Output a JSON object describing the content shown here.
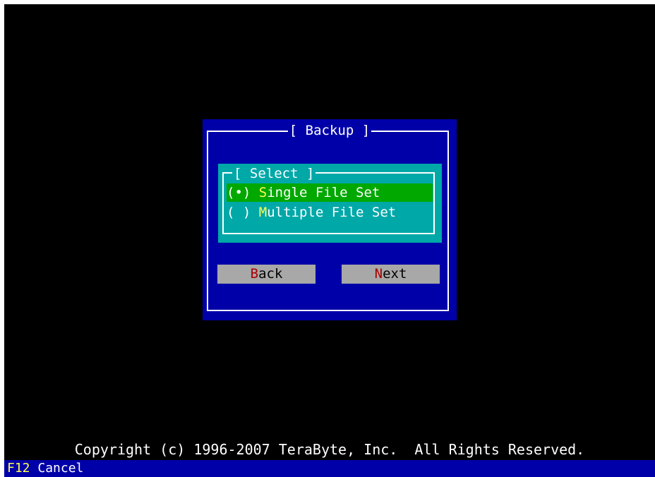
{
  "dialog": {
    "title": "[ Backup ]"
  },
  "select_group": {
    "title": "[ Select ]",
    "options": [
      {
        "marker": "(•) ",
        "hotkey": "S",
        "rest": "ingle File Set",
        "selected": true
      },
      {
        "marker": "( ) ",
        "hotkey": "M",
        "rest": "ultiple File Set",
        "selected": false
      }
    ]
  },
  "buttons": {
    "back": {
      "hotkey": "B",
      "rest": "ack"
    },
    "next": {
      "hotkey": "N",
      "rest": "ext"
    }
  },
  "footer": {
    "copyright": "Copyright (c) 1996-2007 TeraByte, Inc.  All Rights Reserved."
  },
  "status_bar": {
    "key": "F12",
    "action": " Cancel"
  },
  "colors": {
    "screen_background": "#000000",
    "dialog_background": "#0000a8",
    "select_panel_background": "#00a8a8",
    "selected_option_background": "#00a800",
    "button_background": "#a8a8a8",
    "hotkey_yellow": "#ffff54",
    "hotkey_red": "#a80000",
    "status_bar_background": "#0000a8"
  }
}
